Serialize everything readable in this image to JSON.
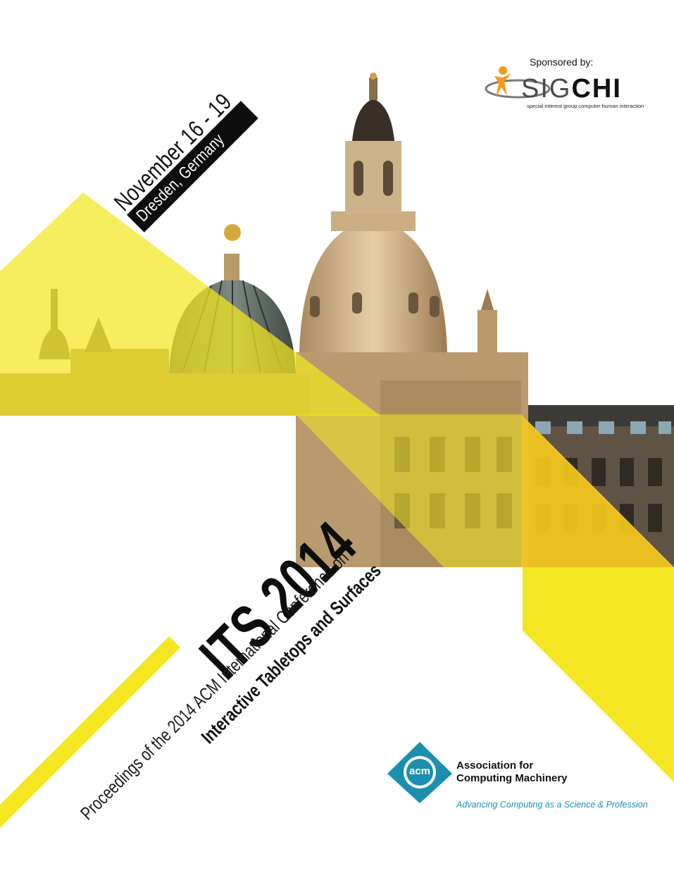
{
  "event": {
    "dates": "November 16 - 19",
    "location": "Dresden, Germany"
  },
  "title": {
    "main": "ITS 2014",
    "proceedings_line": "Proceedings of the 2014 ACM International Conference on",
    "conference_name": "Interactive Tabletops and Surfaces"
  },
  "sponsor": {
    "label": "Sponsored by:",
    "logo_word_left": "SIG",
    "logo_word_right": "CHI",
    "logo_tagline": "special interest group computer human interaction"
  },
  "publisher": {
    "logo_text": "acm",
    "name_line1": "Association for",
    "name_line2": "Computing Machinery",
    "tagline": "Advancing Computing as a Science & Profession"
  },
  "colors": {
    "yellow": "#f4e721",
    "yellow_soft": "#f6ec5a",
    "dark": "#0d0d0d",
    "acm_blue": "#1b8fb0",
    "sigchi_orange": "#f39a1e"
  }
}
